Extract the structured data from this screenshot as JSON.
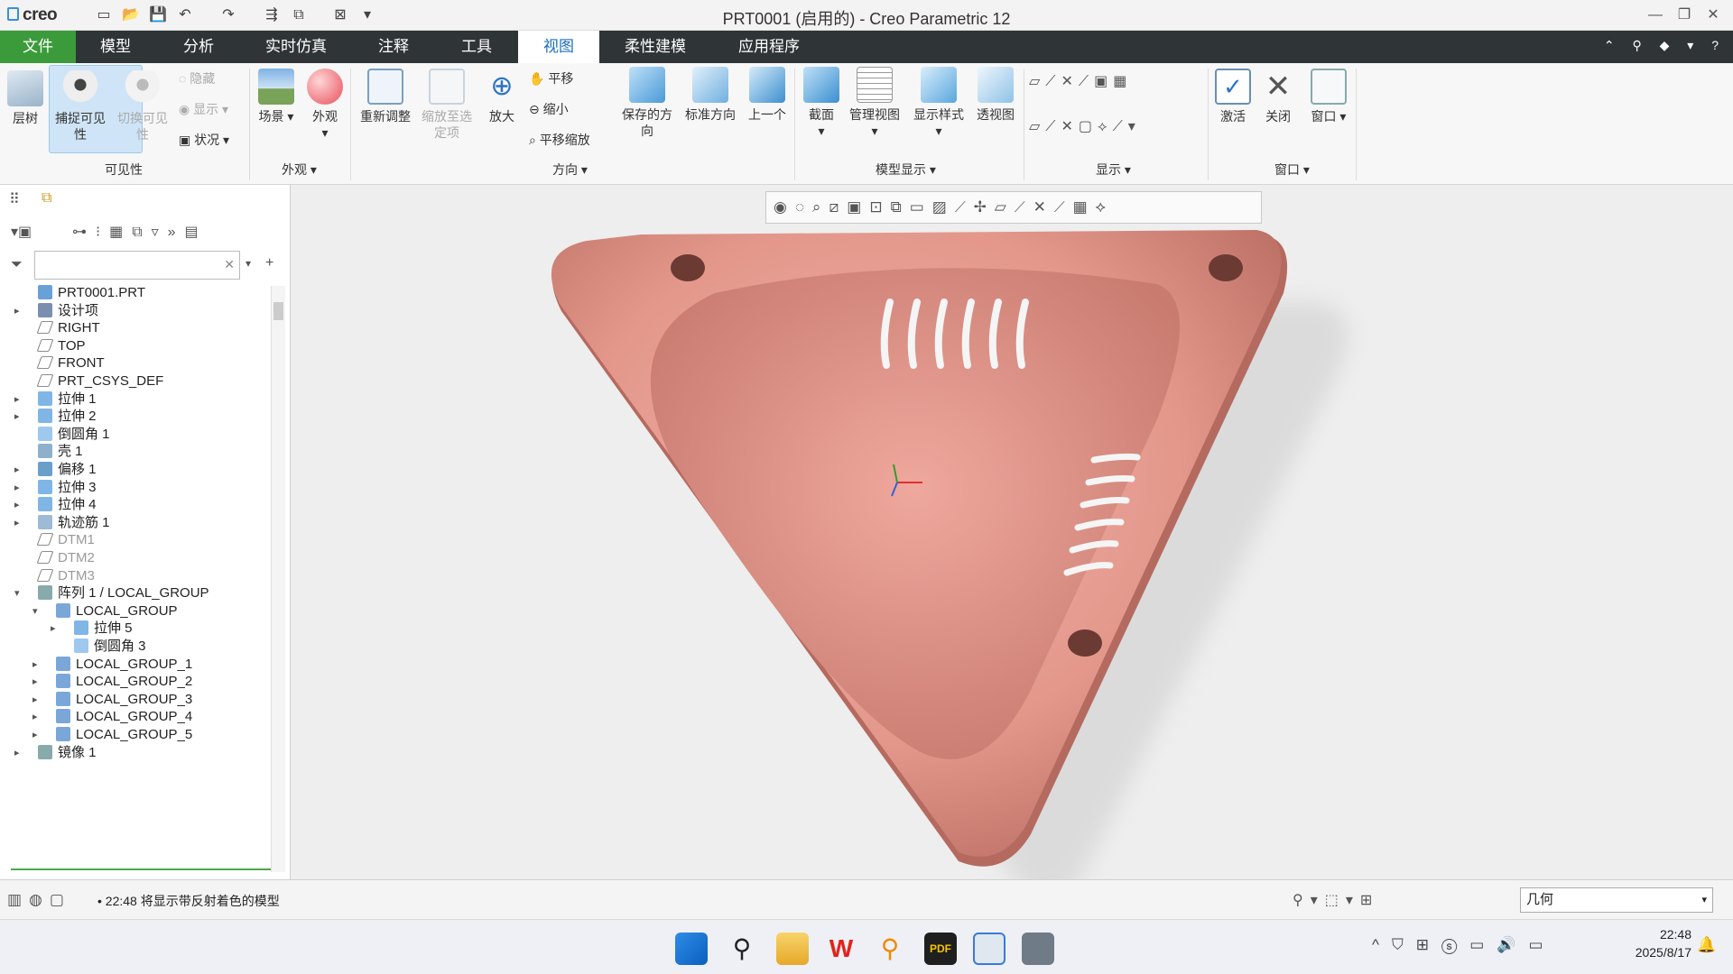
{
  "app": {
    "logo": "creo",
    "window_title": "PRT0001 (启用的) - Creo Parametric 12"
  },
  "menu_tabs": [
    "文件",
    "模型",
    "分析",
    "实时仿真",
    "注释",
    "工具",
    "视图",
    "柔性建模",
    "应用程序"
  ],
  "active_tab": "视图",
  "ribbon": {
    "visibility": {
      "layer_tree": "层树",
      "capture_visibility": "捕捉可见性",
      "toggle_visibility": "切换可见性",
      "hide": "隐藏",
      "show": "显示",
      "status": "状况",
      "group": "可见性"
    },
    "appearance": {
      "scene": "场景",
      "appearance": "外观",
      "group": "外观"
    },
    "orientation": {
      "refit": "重新调整",
      "zoom_to_selected": "缩放至选定项",
      "zoom_in": "放大",
      "pan": "平移",
      "zoom_out": "缩小",
      "pan_zoom": "平移缩放",
      "saved_orientations": "保存的方向",
      "standard_orientation": "标准方向",
      "previous": "上一个",
      "group": "方向"
    },
    "model_display": {
      "section": "截面",
      "manage_views": "管理视图",
      "display_style": "显示样式",
      "perspective": "透视图",
      "group": "模型显示"
    },
    "show": {
      "group": "显示"
    },
    "window": {
      "activate": "激活",
      "close": "关闭",
      "window": "窗口",
      "group": "窗口"
    }
  },
  "tree": [
    {
      "label": "PRT0001.PRT",
      "type": "part",
      "expand": ""
    },
    {
      "label": "设计项",
      "type": "design",
      "expand": "▸"
    },
    {
      "label": "RIGHT",
      "type": "plane",
      "expand": ""
    },
    {
      "label": "TOP",
      "type": "plane",
      "expand": ""
    },
    {
      "label": "FRONT",
      "type": "plane",
      "expand": ""
    },
    {
      "label": "PRT_CSYS_DEF",
      "type": "csys",
      "expand": ""
    },
    {
      "label": "拉伸 1",
      "type": "extrude",
      "expand": "▸"
    },
    {
      "label": "拉伸 2",
      "type": "extrude",
      "expand": "▸"
    },
    {
      "label": "倒圆角 1",
      "type": "round",
      "expand": ""
    },
    {
      "label": "壳 1",
      "type": "shell",
      "expand": ""
    },
    {
      "label": "偏移 1",
      "type": "offset",
      "expand": "▸"
    },
    {
      "label": "拉伸 3",
      "type": "extrude",
      "expand": "▸"
    },
    {
      "label": "拉伸 4",
      "type": "extrude",
      "expand": "▸"
    },
    {
      "label": "轨迹筋 1",
      "type": "rib",
      "expand": "▸"
    },
    {
      "label": "DTM1",
      "type": "plane",
      "expand": "",
      "grey": true
    },
    {
      "label": "DTM2",
      "type": "plane",
      "expand": "",
      "grey": true
    },
    {
      "label": "DTM3",
      "type": "plane",
      "expand": "",
      "grey": true
    },
    {
      "label": "阵列 1 / LOCAL_GROUP",
      "type": "pattern",
      "expand": "▾"
    },
    {
      "label": "LOCAL_GROUP",
      "type": "group",
      "expand": "▾",
      "indent": 1
    },
    {
      "label": "拉伸 5",
      "type": "extrude",
      "expand": "▸",
      "indent": 2
    },
    {
      "label": "倒圆角 3",
      "type": "round",
      "expand": "",
      "indent": 2
    },
    {
      "label": "LOCAL_GROUP_1",
      "type": "group",
      "expand": "▸",
      "indent": 1
    },
    {
      "label": "LOCAL_GROUP_2",
      "type": "group",
      "expand": "▸",
      "indent": 1
    },
    {
      "label": "LOCAL_GROUP_3",
      "type": "group",
      "expand": "▸",
      "indent": 1
    },
    {
      "label": "LOCAL_GROUP_4",
      "type": "group",
      "expand": "▸",
      "indent": 1
    },
    {
      "label": "LOCAL_GROUP_5",
      "type": "group",
      "expand": "▸",
      "indent": 1
    },
    {
      "label": "镜像 1",
      "type": "mirror",
      "expand": "▸"
    }
  ],
  "status": {
    "message": "• 22:48 将显示带反射着色的模型",
    "filter_value": "几何"
  },
  "taskbar": {
    "time": "22:48",
    "date": "2025/8/17"
  },
  "colors": {
    "part": "#e8958a",
    "file_tab": "#3b9b3b",
    "tab_bar": "#2f3436"
  }
}
